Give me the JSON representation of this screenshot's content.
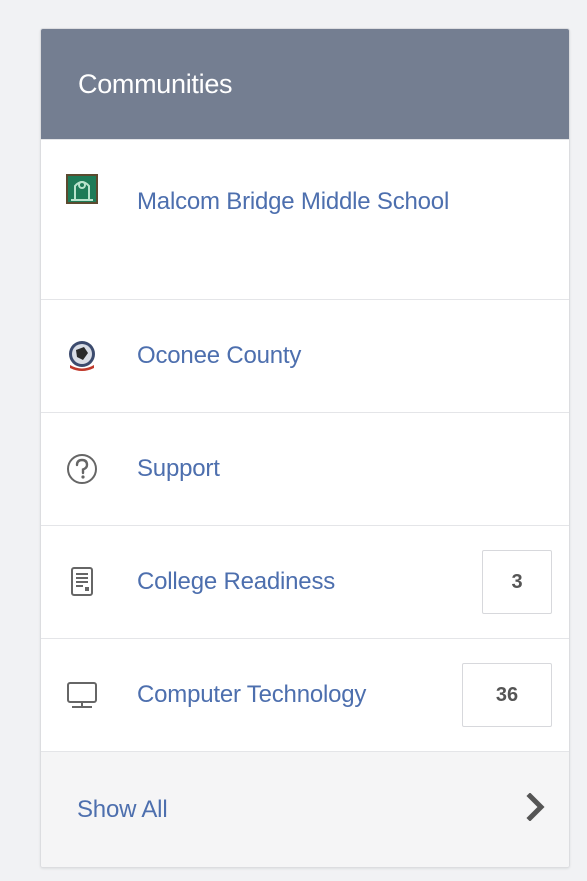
{
  "panel": {
    "title": "Communities",
    "header_color": "#747e91",
    "link_color": "#4d6fae"
  },
  "items": [
    {
      "label": "Malcom Bridge Middle School",
      "icon": "school-building-icon"
    },
    {
      "label": "Oconee County",
      "icon": "county-seal-icon"
    },
    {
      "label": "Support",
      "icon": "question-circle-icon"
    },
    {
      "label": "College Readiness",
      "icon": "document-icon",
      "count": "3"
    },
    {
      "label": "Computer Technology",
      "icon": "monitor-icon",
      "count": "36"
    }
  ],
  "footer": {
    "label": "Show All",
    "icon": "chevron-right-icon"
  }
}
